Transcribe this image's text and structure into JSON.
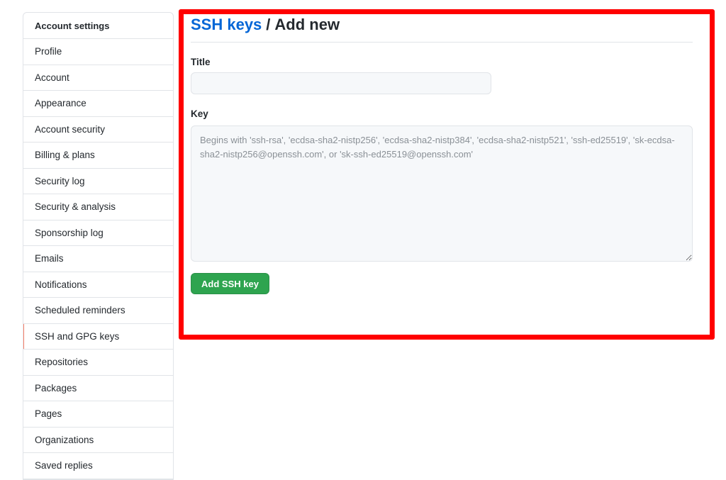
{
  "sidebar": {
    "heading": "Account settings",
    "items": [
      {
        "label": "Profile"
      },
      {
        "label": "Account"
      },
      {
        "label": "Appearance"
      },
      {
        "label": "Account security"
      },
      {
        "label": "Billing & plans"
      },
      {
        "label": "Security log"
      },
      {
        "label": "Security & analysis"
      },
      {
        "label": "Sponsorship log"
      },
      {
        "label": "Emails"
      },
      {
        "label": "Notifications"
      },
      {
        "label": "Scheduled reminders"
      },
      {
        "label": "SSH and GPG keys",
        "selected": true
      },
      {
        "label": "Repositories"
      },
      {
        "label": "Packages"
      },
      {
        "label": "Pages"
      },
      {
        "label": "Organizations"
      },
      {
        "label": "Saved replies"
      }
    ],
    "selected_accent": "#f9826c"
  },
  "header": {
    "breadcrumb_link": "SSH keys",
    "separator": "/",
    "current": "Add new"
  },
  "form": {
    "title_label": "Title",
    "title_value": "",
    "title_placeholder": "",
    "key_label": "Key",
    "key_value": "",
    "key_placeholder": "Begins with 'ssh-rsa', 'ecdsa-sha2-nistp256', 'ecdsa-sha2-nistp384', 'ecdsa-sha2-nistp521', 'ssh-ed25519', 'sk-ecdsa-sha2-nistp256@openssh.com', or 'sk-ssh-ed25519@openssh.com'",
    "submit_label": "Add SSH key"
  },
  "colors": {
    "link": "#0366d6",
    "primary_button": "#2ea44f",
    "highlight_border": "#ff0000"
  }
}
